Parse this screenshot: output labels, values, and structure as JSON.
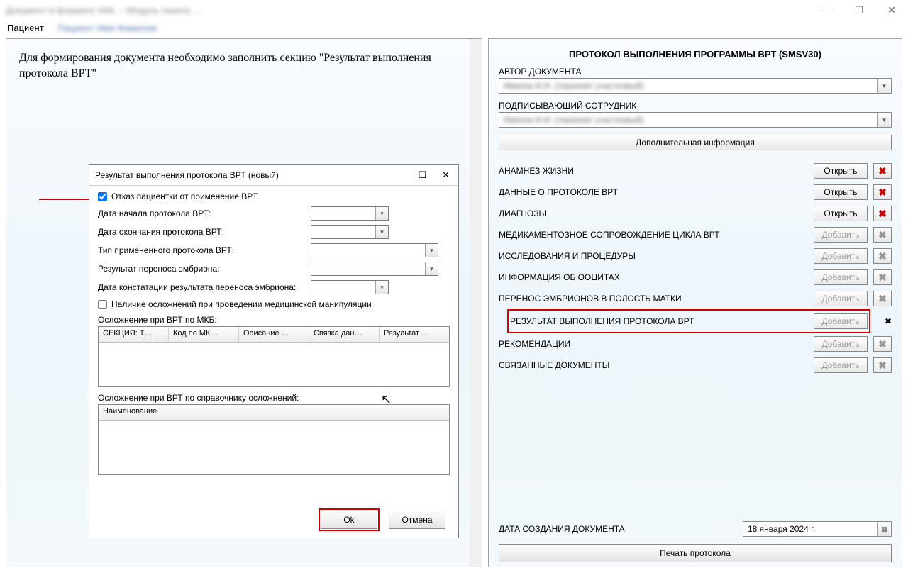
{
  "window": {
    "title_blurred": "Документ в формате XML – Модуль пакета …",
    "min": "—",
    "max": "☐",
    "close": "✕"
  },
  "patientbar": {
    "label": "Пациент",
    "name_blurred": "Пациент Имя Фамилия"
  },
  "left": {
    "instruction": "Для формирования документа необходимо заполнить секцию \"Результат выполнения протокола ВРТ\""
  },
  "dialog": {
    "title": "Результат выполнения протокола ВРТ (новый)",
    "maxIcon": "☐",
    "closeIcon": "✕",
    "checkbox_label": "Отказ пациентки от применение ВРТ",
    "checkbox_checked": true,
    "fields": {
      "start": "Дата начала протокола ВРТ:",
      "end": "Дата окончания протокола ВРТ:",
      "type": "Тип примененного протокола ВРТ:",
      "result_transfer": "Результат переноса эмбриона:",
      "result_date": "Дата констатации результата переноса эмбриона:",
      "complic_check": "Наличие осложнений при проведении медицинской манипуляции",
      "complic_mkb": "Осложнение при ВРТ по МКБ:",
      "complic_dict": "Осложнение при ВРТ по справочнику осложнений:"
    },
    "grid1": [
      "СЕКЦИЯ: Т…",
      "Код по МК…",
      "Описание …",
      "Связка дан…",
      "Результат …"
    ],
    "grid2": [
      "Наименование"
    ],
    "ok": "Ok",
    "cancel": "Отмена"
  },
  "right": {
    "title": "ПРОТОКОЛ ВЫПОЛНЕНИЯ ПРОГРАММЫ ВРТ (SMSV30)",
    "author_label": "АВТОР ДОКУМЕНТА",
    "author_value_blurred": "Иванов И.И. (терапевт участковый)",
    "signer_label": "ПОДПИСЫВАЮЩИЙ СОТРУДНИК",
    "signer_value_blurred": "Иванов И.И. (терапевт участковый)",
    "extra_info_btn": "Дополнительная информация",
    "btn_open": "Открыть",
    "btn_add": "Добавить",
    "sections": [
      {
        "name": "АНАМНЕЗ ЖИЗНИ",
        "btn": "open",
        "disabled": false
      },
      {
        "name": "ДАННЫЕ О ПРОТОКОЛЕ ВРТ",
        "btn": "open",
        "disabled": false
      },
      {
        "name": "ДИАГНОЗЫ",
        "btn": "open",
        "disabled": false
      },
      {
        "name": "МЕДИКАМЕНТОЗНОЕ СОПРОВОЖДЕНИЕ ЦИКЛА ВРТ",
        "btn": "add",
        "disabled": true
      },
      {
        "name": "ИССЛЕДОВАНИЯ И ПРОЦЕДУРЫ",
        "btn": "add",
        "disabled": true
      },
      {
        "name": "ИНФОРМАЦИЯ ОБ ООЦИТАХ",
        "btn": "add",
        "disabled": true
      },
      {
        "name": "ПЕРЕНОС ЭМБРИОНОВ В ПОЛОСТЬ МАТКИ",
        "btn": "add",
        "disabled": true
      },
      {
        "name": "РЕЗУЛЬТАТ ВЫПОЛНЕНИЯ ПРОТОКОЛА ВРТ",
        "btn": "add",
        "disabled": true,
        "highlight": true
      },
      {
        "name": "РЕКОМЕНДАЦИИ",
        "btn": "add",
        "disabled": true
      },
      {
        "name": "СВЯЗАННЫЕ ДОКУМЕНТЫ",
        "btn": "add",
        "disabled": true
      }
    ],
    "date_label": "ДАТА СОЗДАНИЯ ДОКУМЕНТА",
    "date_value": "18   января   2024 г.",
    "print_btn": "Печать протокола"
  }
}
